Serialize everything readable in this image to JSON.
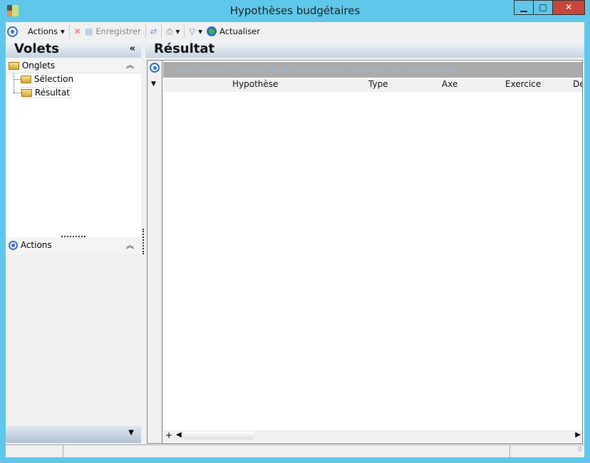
{
  "window": {
    "title": "Hypothèses budgétaires",
    "minimize": "▁",
    "maximize": "□",
    "close": "✕"
  },
  "toolbar": {
    "actions": "Actions",
    "save": "Enregistrer",
    "refresh": "Actualiser"
  },
  "left": {
    "title": "Volets",
    "collapse": "«",
    "tabs_group": "Onglets",
    "tabs": [
      {
        "label": "Sélection"
      },
      {
        "label": "Résultat"
      }
    ],
    "actions_group": "Actions",
    "chevron_up": "⌃"
  },
  "main": {
    "title": "Résultat",
    "group_hint": "Faire glisser ici l'entête d'une colonne pour regrouper sur cette colonne.",
    "columns": [
      "Hypothèse",
      "Type",
      "Axe",
      "Exercice",
      "Dé"
    ],
    "add": "+"
  }
}
